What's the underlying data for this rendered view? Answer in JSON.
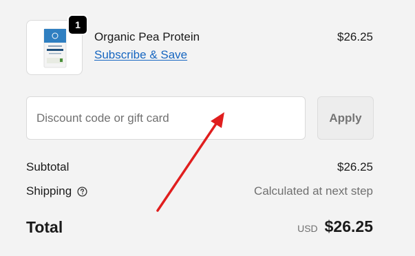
{
  "product": {
    "name": "Organic Pea Protein",
    "quantity": "1",
    "link_label": "Subscribe & Save",
    "price": "$26.25"
  },
  "discount": {
    "placeholder": "Discount code or gift card",
    "value": "",
    "apply_label": "Apply"
  },
  "summary": {
    "subtotal_label": "Subtotal",
    "subtotal_value": "$26.25",
    "shipping_label": "Shipping",
    "shipping_value": "Calculated at next step",
    "total_label": "Total",
    "currency": "USD",
    "total_value": "$26.25"
  },
  "icons": {
    "shipping_help": "question-circle-icon",
    "product_image": "pea-protein-bag-icon"
  },
  "colors": {
    "link": "#1565c0",
    "badge_bg": "#000000",
    "annotation": "#e01e1e",
    "background": "#f3f3f3"
  }
}
